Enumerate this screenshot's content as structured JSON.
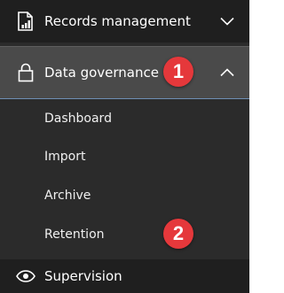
{
  "nav": {
    "records": {
      "label": "Records management",
      "icon": "document-chart-icon",
      "chevron": "chevron-down-icon"
    },
    "governance": {
      "label": "Data governance",
      "icon": "lock-icon",
      "chevron": "chevron-up-icon",
      "expanded": true
    },
    "submenu": [
      {
        "label": "Dashboard"
      },
      {
        "label": "Import"
      },
      {
        "label": "Archive"
      },
      {
        "label": "Retention"
      }
    ],
    "supervision": {
      "label": "Supervision",
      "icon": "eye-icon"
    }
  },
  "callouts": [
    {
      "number": "1",
      "color": "#e5383b"
    },
    {
      "number": "2",
      "color": "#e5383b"
    }
  ]
}
